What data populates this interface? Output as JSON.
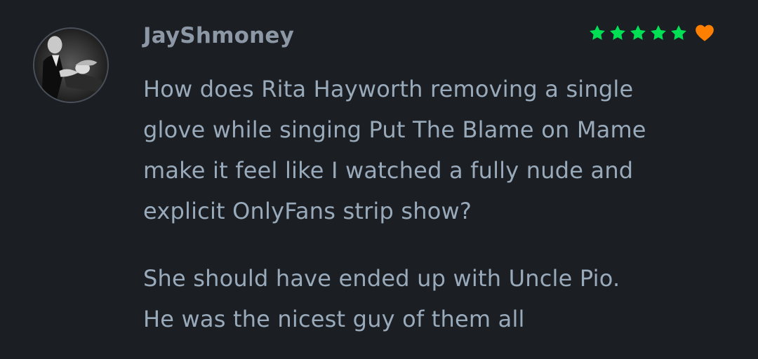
{
  "review": {
    "author": {
      "username": "JayShmoney",
      "avatar_icon": "avatar-photo-icon"
    },
    "rating": {
      "stars": 5,
      "max_stars": 5,
      "liked": true,
      "star_color": "#00e054",
      "heart_color": "#ff8000",
      "star_icon": "star-icon",
      "heart_icon": "heart-icon"
    },
    "paragraphs": [
      {
        "lines": [
          "How does Rita Hayworth removing a single",
          "glove while singing Put The Blame on Mame",
          "make it feel like I watched a fully nude and",
          "explicit OnlyFans strip show?"
        ]
      },
      {
        "lines": [
          "She should have ended up with Uncle Pio.",
          "He was the nicest guy of them all"
        ]
      }
    ]
  },
  "colors": {
    "background": "#1b1e23",
    "username": "#8d98a6",
    "body_text": "#99aabb"
  }
}
